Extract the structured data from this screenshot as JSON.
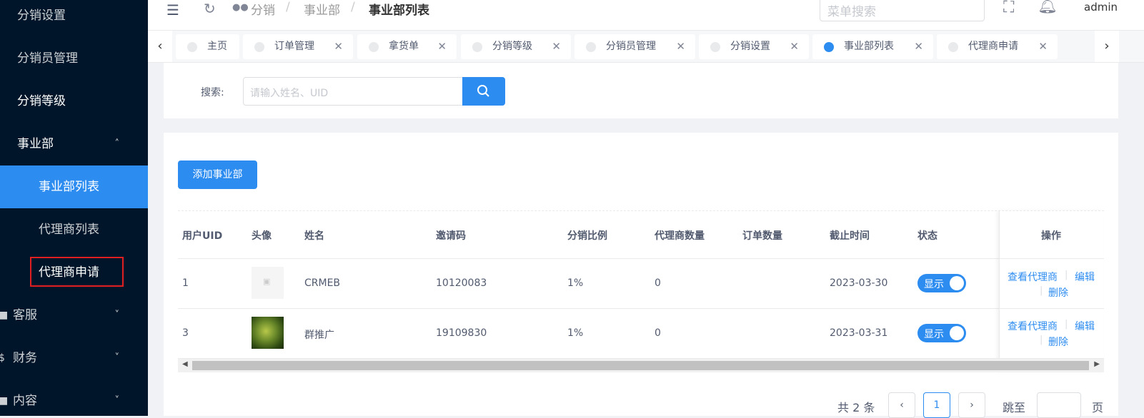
{
  "sidebar": {
    "items": [
      {
        "label": "分销设置"
      },
      {
        "label": "分销员管理"
      },
      {
        "label": "分销等级"
      },
      {
        "label": "事业部"
      },
      {
        "label": "事业部列表"
      },
      {
        "label": "代理商列表"
      },
      {
        "label": "代理商申请"
      },
      {
        "label": "客服"
      },
      {
        "label": "财务"
      },
      {
        "label": "内容"
      }
    ]
  },
  "header": {
    "breadcrumb": [
      "分销",
      "事业部",
      "事业部列表"
    ],
    "search_placeholder": "菜单搜索",
    "user": "admin"
  },
  "tabs": [
    {
      "label": "主页"
    },
    {
      "label": "订单管理"
    },
    {
      "label": "拿货单"
    },
    {
      "label": "分销等级"
    },
    {
      "label": "分销员管理"
    },
    {
      "label": "分销设置"
    },
    {
      "label": "事业部列表"
    },
    {
      "label": "代理商申请"
    }
  ],
  "search": {
    "label": "搜索:",
    "placeholder": "请输入姓名、UID"
  },
  "add_button": "添加事业部",
  "table": {
    "headers": [
      "用户UID",
      "头像",
      "姓名",
      "邀请码",
      "分销比例",
      "代理商数量",
      "订单数量",
      "截止时间",
      "状态",
      "操作"
    ],
    "rows": [
      {
        "uid": "1",
        "name": "CRMEB",
        "code": "10120083",
        "ratio": "1%",
        "agents": "0",
        "orders": "",
        "deadline": "2023-03-30",
        "status": "显示"
      },
      {
        "uid": "3",
        "name": "群推广",
        "code": "19109830",
        "ratio": "1%",
        "agents": "0",
        "orders": "",
        "deadline": "2023-03-31",
        "status": "显示"
      }
    ],
    "actions": {
      "view": "查看代理商",
      "edit": "编辑",
      "delete": "删除"
    }
  },
  "pagination": {
    "total": "共 2 条",
    "current": "1",
    "jump": "跳至",
    "page_unit": "页"
  }
}
